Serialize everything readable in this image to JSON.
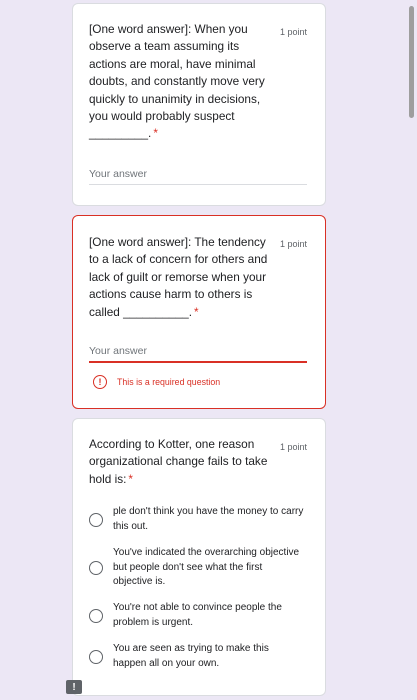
{
  "questions": [
    {
      "text": "[One word answer]: When you observe a team assuming its actions are moral, have minimal doubts, and constantly move very quickly to unanimity in decisions, you would probably suspect _________.",
      "required_mark": "*",
      "points": "1 point",
      "answer_placeholder": "Your answer"
    },
    {
      "text": "[One word answer]: The tendency to a lack of concern for others and lack of guilt or remorse when your actions cause harm to others is called __________.",
      "required_mark": "*",
      "points": "1 point",
      "answer_placeholder": "Your answer",
      "error_message": "This is a required question"
    },
    {
      "text": "According to Kotter, one reason organizational change fails to take hold is:",
      "required_mark": "*",
      "points": "1 point",
      "options": [
        "ple don't think you have the money to carry this out.",
        "You've indicated the overarching objective but people don't see what the first objective is.",
        "You're not able to convince people the problem is urgent.",
        "You are seen as trying to make this happen all on your own."
      ]
    }
  ],
  "error_icon_glyph": "!",
  "report_icon_glyph": "!",
  "colors": {
    "background": "#ece7f5",
    "error": "#d93025",
    "card": "#ffffff"
  }
}
